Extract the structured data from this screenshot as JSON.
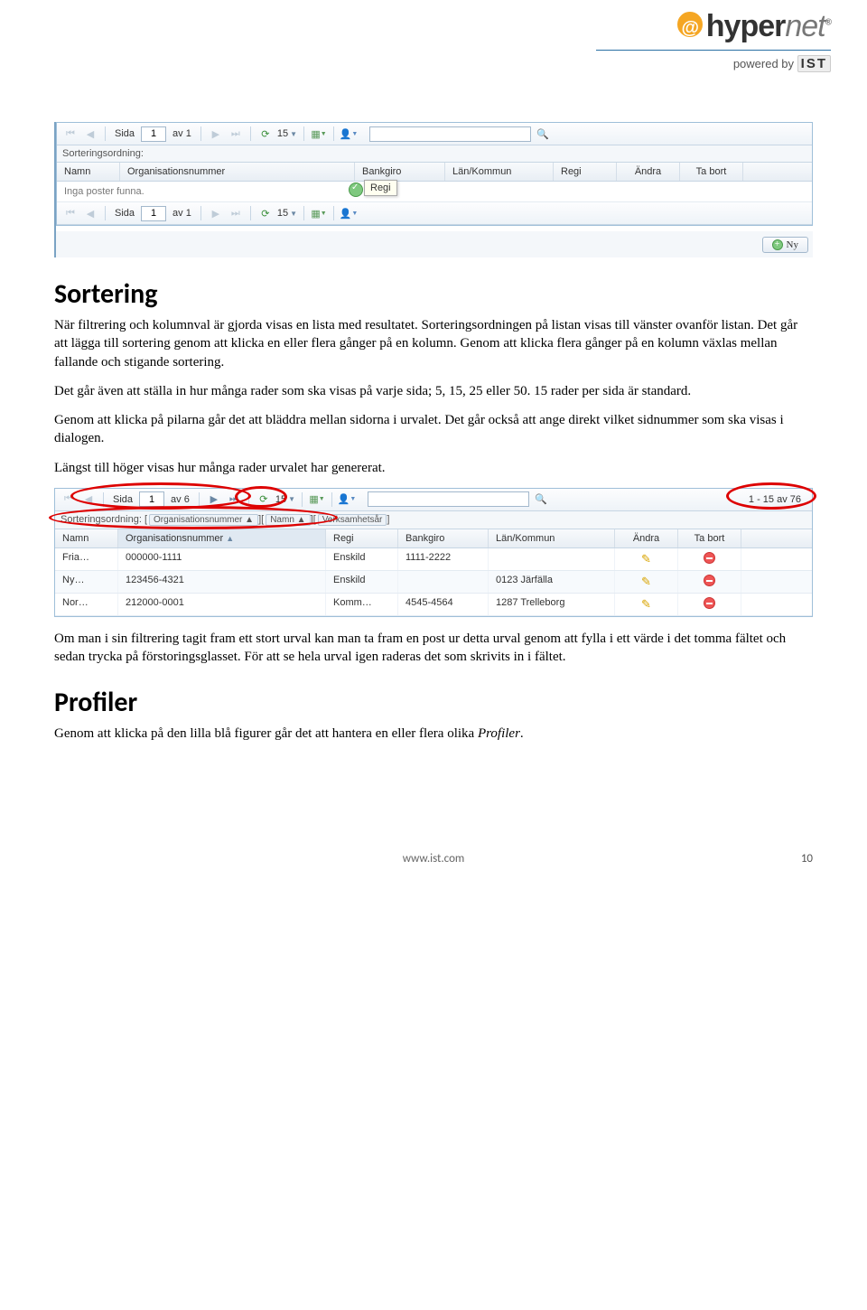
{
  "logo": {
    "name": "hyper",
    "suffix": "net",
    "powered": "powered by",
    "ist": "IST"
  },
  "fig1": {
    "toolbar": {
      "page_label": "Sida",
      "page_value": "1",
      "of_label": "av 1",
      "rows_per_page": "15"
    },
    "sort_label": "Sorteringsordning:",
    "columns": {
      "name": "Namn",
      "org": "Organisationsnummer",
      "bank": "Bankgiro",
      "lan": "Län/Kommun",
      "regi": "Regi",
      "andra": "Ändra",
      "ta": "Ta bort"
    },
    "empty": "Inga poster funna.",
    "tooltip": "Regi",
    "ny": "Ny"
  },
  "text": {
    "h1": "Sortering",
    "p1": "När filtrering och kolumnval är gjorda visas en lista med resultatet. Sorteringsordningen på listan visas till vänster ovanför listan. Det går att lägga till sortering genom att klicka en eller flera gånger på en kolumn. Genom att klicka flera gånger på en kolumn växlas mellan fallande och stigande sortering.",
    "p2": "Det går även att ställa in hur många rader som ska visas på varje sida; 5, 15, 25 eller 50. 15 rader per sida är standard.",
    "p3": "Genom att klicka på pilarna går det att bläddra mellan sidorna i urvalet. Det går också att ange direkt vilket sidnummer som ska visas i dialogen.",
    "p4": "Längst till höger visas hur många rader urvalet har genererat.",
    "p5": "Om man i sin filtrering tagit fram ett stort urval kan man ta fram en post ur detta urval genom att fylla i ett värde i det tomma fältet och sedan trycka på förstoringsglasset. För att se hela urval igen raderas det som skrivits in i fältet.",
    "h2": "Profiler",
    "p6a": "Genom att klicka på den lilla blå figurer går det att hantera en eller flera olika ",
    "p6b": "Profiler",
    "p6c": "."
  },
  "fig2": {
    "toolbar": {
      "page_label": "Sida",
      "page_value": "1",
      "of_label": "av 6",
      "rows_per_page": "15",
      "result": "1 - 15 av 76"
    },
    "sort_label": "Sorteringsordning:",
    "sort_tags": [
      "Organisationsnummer ▲",
      "Namn ▲",
      "Verksamhetsår"
    ],
    "columns": {
      "name": "Namn",
      "org": "Organisationsnummer",
      "regi": "Regi",
      "bank": "Bankgiro",
      "lan": "Län/Kommun",
      "andra": "Ändra",
      "ta": "Ta bort"
    },
    "rows": [
      {
        "name": "Fria…",
        "org": "000000-1111",
        "regi": "Enskild",
        "bank": "1111-2222",
        "lan": ""
      },
      {
        "name": "Ny…",
        "org": "123456-4321",
        "regi": "Enskild",
        "bank": "",
        "lan": "0123 Järfälla"
      },
      {
        "name": "Nor…",
        "org": "212000-0001",
        "regi": "Komm…",
        "bank": "4545-4564",
        "lan": "1287 Trelleborg"
      }
    ]
  },
  "footer": {
    "url": "www.ist.com",
    "page": "10"
  }
}
